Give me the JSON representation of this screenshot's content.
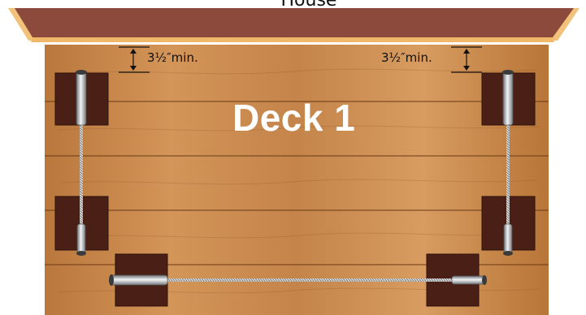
{
  "labels": {
    "house": "House",
    "deck": "Deck 1",
    "clearance_left": "3½″min.",
    "clearance_right": "3½″min."
  },
  "colors": {
    "roof_top": "#8b4a3c",
    "roof_edge": "#f3c27a",
    "wood_light": "#c98a4c",
    "wood_dark": "#a9652d",
    "post": "#4a1f16",
    "cable": "#e6e6e6",
    "hardware": "#9aa0a6"
  }
}
